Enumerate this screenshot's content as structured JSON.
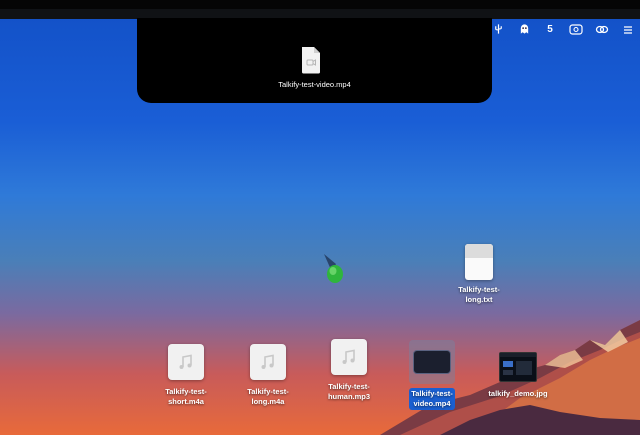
{
  "colors": {
    "sky_top": "#1250c6",
    "sky_bottom": "#e86a3a",
    "selection": "#1a5fd0",
    "notch_panel": "#000000"
  },
  "menubar": {
    "icons": [
      "settings-icon",
      "usb-fork-icon",
      "ghost-icon",
      "badge-count",
      "capture-icon",
      "link-icon",
      "menu-icon"
    ],
    "badge_count": "5"
  },
  "notch_panel": {
    "file_icon": "video-file-icon",
    "file_label": "Talkify-test-video.mp4"
  },
  "desktop": {
    "files": [
      {
        "name": "Talkify-test-long.txt",
        "line1": "Talkify-test-",
        "line2": "long.txt",
        "icon": "text-file-icon"
      },
      {
        "name": "Talkify-test-short.m4a",
        "line1": "Talkify-test-",
        "line2": "short.m4a",
        "icon": "music-file-icon"
      },
      {
        "name": "Talkify-test-long.m4a",
        "line1": "Talkify-test-",
        "line2": "long.m4a",
        "icon": "music-file-icon"
      },
      {
        "name": "Talkify-test-human.mp3",
        "line1": "Talkify-test-",
        "line2": "human.mp3",
        "icon": "music-file-icon"
      },
      {
        "name": "Talkify-test-video.mp4",
        "line1": "Talkify-test-",
        "line2": "video.mp4",
        "icon": "video-file-icon",
        "selected": true
      },
      {
        "name": "talkify_demo.jpg",
        "line1": "talkify_demo.jpg",
        "line2": "",
        "icon": "image-file-icon"
      }
    ]
  }
}
